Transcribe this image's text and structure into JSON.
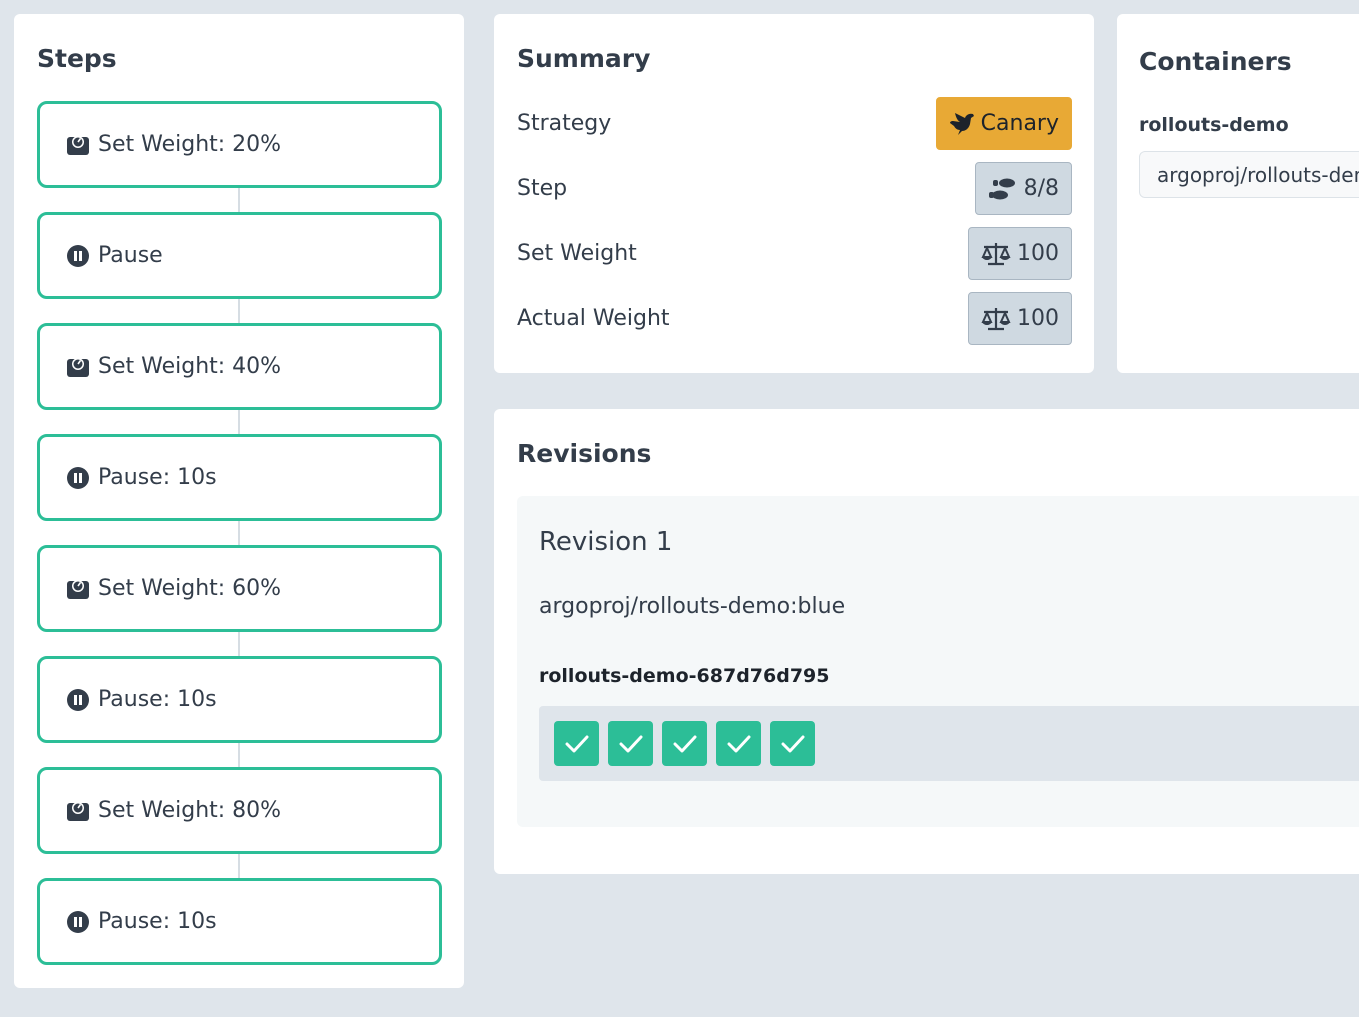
{
  "steps": {
    "title": "Steps",
    "items": [
      {
        "icon": "weight-scale-icon",
        "label": "Set Weight: 20%"
      },
      {
        "icon": "pause-icon",
        "label": "Pause"
      },
      {
        "icon": "weight-scale-icon",
        "label": "Set Weight: 40%"
      },
      {
        "icon": "pause-icon",
        "label": "Pause: 10s"
      },
      {
        "icon": "weight-scale-icon",
        "label": "Set Weight: 60%"
      },
      {
        "icon": "pause-icon",
        "label": "Pause: 10s"
      },
      {
        "icon": "weight-scale-icon",
        "label": "Set Weight: 80%"
      },
      {
        "icon": "pause-icon",
        "label": "Pause: 10s"
      }
    ]
  },
  "summary": {
    "title": "Summary",
    "rows": [
      {
        "label": "Strategy",
        "value": "Canary",
        "icon": "dove-icon"
      },
      {
        "label": "Step",
        "value": "8/8",
        "icon": "shoe-prints-icon"
      },
      {
        "label": "Set Weight",
        "value": "100",
        "icon": "balance-scale-icon"
      },
      {
        "label": "Actual Weight",
        "value": "100",
        "icon": "balance-scale-icon"
      }
    ]
  },
  "containers": {
    "title": "Containers",
    "items": [
      {
        "name": "rollouts-demo",
        "image": "argoproj/rollouts-demo:blue"
      }
    ]
  },
  "revisions": {
    "title": "Revisions",
    "items": [
      {
        "title": "Revision 1",
        "image": "argoproj/rollouts-demo:blue",
        "replicaset": "rollouts-demo-687d76d795",
        "pods": [
          "check-icon",
          "check-icon",
          "check-icon",
          "check-icon",
          "check-icon"
        ]
      }
    ]
  },
  "colors": {
    "background": "#dfe5eb",
    "step_border": "#2cbe97",
    "pod_healthy": "#2cbe97",
    "canary_badge": "#e8a935",
    "pill_bg": "#cfd9e1",
    "text": "#333d4a"
  }
}
